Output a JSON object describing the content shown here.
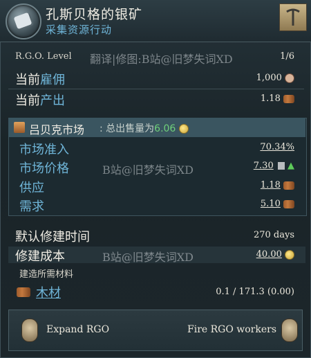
{
  "header": {
    "title": "孔斯贝格的银矿",
    "subtitle": "采集资源行动"
  },
  "rgo": {
    "level_label": "R.G.O. Level",
    "level_value": "1/6",
    "watermark_top": "翻译|修图:B站@旧梦失词XD"
  },
  "employment": {
    "label_prefix": "当前",
    "label_highlight": "雇佣",
    "value": "1,000"
  },
  "output": {
    "label_prefix": "当前",
    "label_highlight": "产出",
    "value": "1.18"
  },
  "market": {
    "name": "吕贝克市场",
    "sales_prefix": "总出售量为",
    "sales_value": "6.06",
    "access_label": "市场准入",
    "access_value": "70.34%",
    "price_label": "市场价格",
    "price_value": "7.30",
    "supply_label": "供应",
    "supply_value": "1.18",
    "demand_label": "需求",
    "demand_value": "5.10",
    "watermark": "B站@旧梦失词XD"
  },
  "build": {
    "time_label": "默认修建时间",
    "time_value": "270 days",
    "cost_label": "修建成本",
    "cost_value": "40.00",
    "materials_label": "建造所需材料",
    "watermark": "B站@旧梦失词XD"
  },
  "material": {
    "name": "木材",
    "value": "0.1 / 171.3 (0.00)"
  },
  "footer": {
    "expand_label": "Expand RGO",
    "fire_label": "Fire RGO workers"
  },
  "colors": {
    "accent_blue": "#6fb5d8",
    "positive_green": "#6fd07a"
  },
  "icons": [
    "silver-ore-icon",
    "pickaxe-icon",
    "worker-icon",
    "wood-icon",
    "market-icon",
    "coin-icon",
    "price-trend-icon",
    "up-arrow-icon",
    "expand-icon",
    "fire-workers-icon"
  ]
}
